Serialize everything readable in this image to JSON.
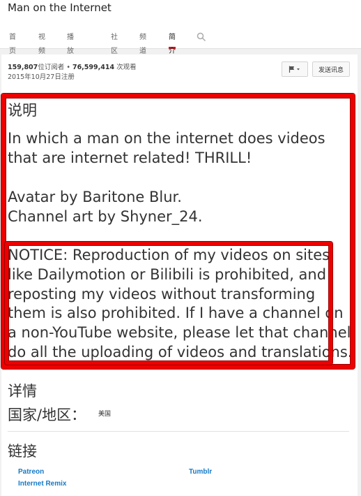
{
  "channel": {
    "title": "Man on the Internet"
  },
  "tabs": [
    {
      "label": "首页",
      "active": false
    },
    {
      "label": "视频",
      "active": false
    },
    {
      "label": "播放列表",
      "active": false
    },
    {
      "label": "社区",
      "active": false
    },
    {
      "label": "频道",
      "active": false
    },
    {
      "label": "简介",
      "active": true
    }
  ],
  "search": {
    "icon": "search-icon"
  },
  "stats": {
    "subscribers": "159,807",
    "subscribers_suffix": "位订阅者",
    "separator": " • ",
    "views": "76,599,414",
    "views_suffix": " 次观看",
    "joined": "2015年10月27日注册"
  },
  "actions": {
    "flag_icon": "flag-icon",
    "message_label": "发送讯息"
  },
  "description": {
    "heading": "说明",
    "text": "In which a man on the internet does videos that are internet related! THRILL!\n\nAvatar by Baritone Blur.\nChannel art by Shyner_24.",
    "notice": "NOTICE: Reproduction of my videos on sites like Dailymotion or Bilibili is prohibited, and reposting my videos without transforming them is also prohibited. If I have a channel on a non-YouTube website, please let that channel do all the uploading of videos and translations."
  },
  "details": {
    "heading": "详情",
    "country_label": "国家/地区：",
    "country_value": "美国"
  },
  "links": {
    "heading": "链接",
    "items": [
      {
        "label": "Patreon"
      },
      {
        "label": "Tumblr"
      },
      {
        "label": "Internet Remix"
      }
    ]
  },
  "colors": {
    "highlight": "#ee0000",
    "tab_active": "#cc181e",
    "link": "#167ac6"
  }
}
